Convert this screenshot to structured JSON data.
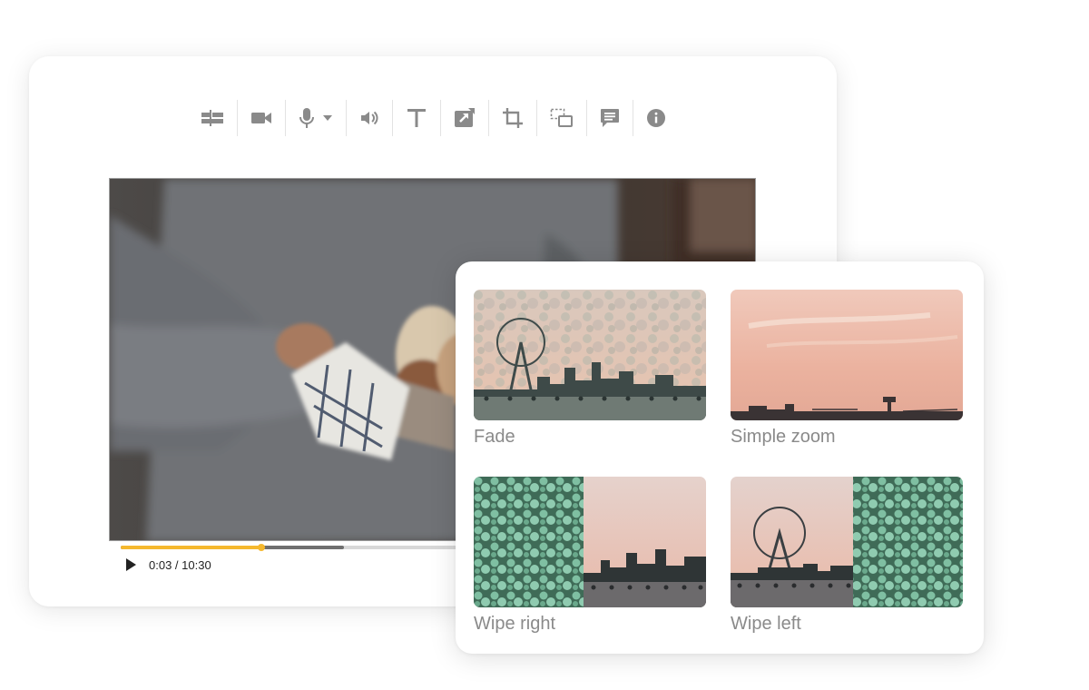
{
  "toolbar": {
    "tools": [
      {
        "name": "timeline-tool",
        "icon": "timeline-icon"
      },
      {
        "name": "record-camera-tool",
        "icon": "video-camera-icon"
      },
      {
        "name": "microphone-tool",
        "icon": "microphone-icon"
      },
      {
        "name": "volume-tool",
        "icon": "speaker-icon"
      },
      {
        "name": "text-tool",
        "icon": "text-icon"
      },
      {
        "name": "export-tool",
        "icon": "share-icon"
      },
      {
        "name": "crop-tool",
        "icon": "crop-icon"
      },
      {
        "name": "resize-tool",
        "icon": "resize-icon"
      },
      {
        "name": "comment-tool",
        "icon": "comment-icon"
      },
      {
        "name": "info-tool",
        "icon": "info-icon"
      }
    ]
  },
  "player": {
    "timecode": "0:03 / 10:30",
    "progress_fraction": 0.225,
    "buffered_fraction": 0.357
  },
  "transitions": [
    {
      "label": "Fade"
    },
    {
      "label": "Simple zoom"
    },
    {
      "label": "Wipe right"
    },
    {
      "label": "Wipe left"
    }
  ],
  "colors": {
    "accent": "#f5b82e",
    "icon": "#8a8a8a",
    "label": "#8a8a8a"
  }
}
